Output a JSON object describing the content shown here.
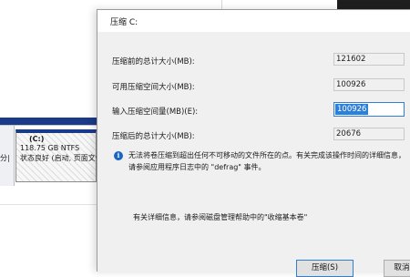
{
  "background": {
    "disk_label": "分|",
    "partition": {
      "name": "(C:)",
      "size": "118.75 GB NTFS",
      "status": "状态良好 (启动, 页面文件"
    }
  },
  "dialog": {
    "title": "压缩 C:",
    "fields": [
      {
        "label": "压缩前的总计大小(MB):",
        "value": "121602"
      },
      {
        "label": "可用压缩空间大小(MB):",
        "value": "100926"
      },
      {
        "label": "输入压缩空间量(MB)(E):",
        "value": "100926"
      },
      {
        "label": "压缩后的总计大小(MB):",
        "value": "20676"
      }
    ],
    "info_text": "无法将卷压缩到超出任何不可移动的文件所在的点。有关完成该操作时间的详细信息，请参阅应用程序日志中的 \"defrag\" 事件。",
    "help_text": "有关详细信息，请参阅磁盘管理帮助中的\"收缩基本卷\"",
    "buttons": {
      "primary": "压缩(S)",
      "cancel": "取消"
    }
  }
}
